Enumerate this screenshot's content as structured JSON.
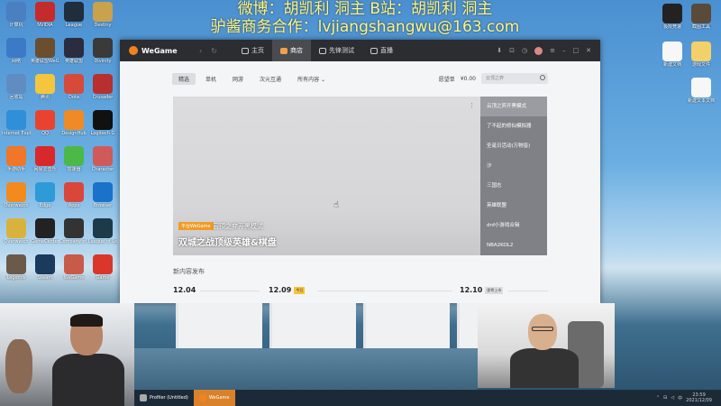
{
  "overlay": {
    "line1": "微博：胡凯利 洞主 B站：胡凯利 洞主",
    "line2": "驴酱商务合作：lvjiangshangwu@163.com"
  },
  "desktop_icons_left": [
    {
      "label": "计算机",
      "color": "#4a7fc0"
    },
    {
      "label": "NVIDIA",
      "color": "#c62b2b"
    },
    {
      "label": "League",
      "color": "#1f2d3c"
    },
    {
      "label": "Destiny",
      "color": "#c9a24b"
    },
    {
      "label": "网络",
      "color": "#3c7ac7"
    },
    {
      "label": "英雄联盟WeGame版",
      "color": "#6a4e2e"
    },
    {
      "label": "英雄联盟",
      "color": "#2c2c40"
    },
    {
      "label": "Divinity",
      "color": "#3a3a3a"
    },
    {
      "label": "回收站",
      "color": "#5f8dc2"
    },
    {
      "label": "腾讯",
      "color": "#f3c63d"
    },
    {
      "label": "Dota",
      "color": "#d64a3a"
    },
    {
      "label": "Crusader",
      "color": "#b82f2f"
    },
    {
      "label": "Internet Explorer",
      "color": "#2f8fd8"
    },
    {
      "label": "QQ",
      "color": "#e8432f"
    },
    {
      "label": "DesignHub",
      "color": "#f08a24"
    },
    {
      "label": "Logitech G",
      "color": "#111"
    },
    {
      "label": "手游助手",
      "color": "#f0762a"
    },
    {
      "label": "网易云音乐",
      "color": "#d9282b"
    },
    {
      "label": "加速器",
      "color": "#4cb848"
    },
    {
      "label": "Character",
      "color": "#d05a5a"
    },
    {
      "label": "Overwatch",
      "color": "#f28a1e"
    },
    {
      "label": "Edge",
      "color": "#2e9ad8"
    },
    {
      "label": "Apps",
      "color": "#d9463a"
    },
    {
      "label": "Browser",
      "color": "#1a72c9"
    },
    {
      "label": "Overwatch",
      "color": "#d9b23d"
    },
    {
      "label": "GameCenter",
      "color": "#222"
    },
    {
      "label": "Company of Heroes 2",
      "color": "#333"
    },
    {
      "label": "League of Legends",
      "color": "#1d3a4a"
    },
    {
      "label": "Legends",
      "color": "#6b5a4a"
    },
    {
      "label": "Steam",
      "color": "#1b3a5c"
    },
    {
      "label": "WeGame",
      "color": "#c85a4a"
    },
    {
      "label": "Game",
      "color": "#d9372b"
    }
  ],
  "desktop_icons_right": [
    {
      "label": "极限竞速",
      "color": "#222"
    },
    {
      "label": "截图工具",
      "color": "#5a4a3a"
    },
    {
      "label": "游戏文件",
      "color": "#f3d06a"
    },
    {
      "label": "新建文本文档",
      "color": "#f7f7f7"
    },
    {
      "label": "新建文档",
      "color": "#f7f7f7"
    }
  ],
  "wegame": {
    "logo": "WeGame",
    "tabs": [
      {
        "label": "主页",
        "active": false
      },
      {
        "label": "商店",
        "active": true
      },
      {
        "label": "先锋测试",
        "active": false
      },
      {
        "label": "直播",
        "active": false
      }
    ],
    "subtabs": [
      {
        "label": "精选",
        "active": true
      },
      {
        "label": "单机",
        "active": false
      },
      {
        "label": "网游",
        "active": false
      },
      {
        "label": "次元互通",
        "active": false
      },
      {
        "label": "所有内容",
        "active": false
      }
    ],
    "sub_right": {
      "link1": "愿望单",
      "link2": "¥0.00",
      "search_placeholder": "云顶之弈"
    },
    "banner": {
      "badge": "平台WeGame",
      "subtitle": "云顶之弈开黑模式",
      "title": "双城之战顶级英雄&棋盘"
    },
    "side_items": [
      "云顶之弈开黑模式",
      "了不起的修仙模拟器",
      "圣诞日活动(万物皆)",
      "沙",
      "三国志",
      "英雄联盟",
      "dnf小游戏合辑",
      "NBA2KOL2"
    ],
    "new_section": "新内容发布",
    "dates": [
      {
        "label": "12.04",
        "tag": ""
      },
      {
        "label": "12.09",
        "tag": "今日"
      },
      {
        "label": "12.10",
        "tag": "即将上市"
      }
    ]
  },
  "taskbar": {
    "items": [
      {
        "label": "Profiler (Untitled)",
        "active": false
      },
      {
        "label": "WeGame",
        "active": true
      }
    ],
    "time": "23:59",
    "date": "2021/12/09"
  },
  "colors": {
    "wegame_top": "#2b2d30",
    "accent_orange": "#f0831e",
    "side_panel": "#7f8186",
    "taskbar_bg": "#1c2a38"
  }
}
